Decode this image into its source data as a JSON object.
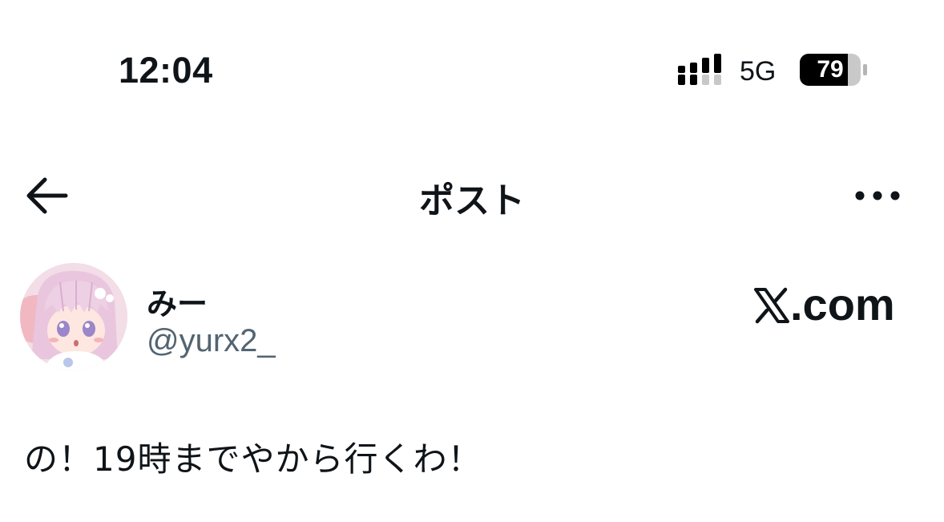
{
  "status_bar": {
    "time": "12:04",
    "network": "5G",
    "battery": "79",
    "battery_level_percent": 79
  },
  "nav": {
    "title": "ポスト",
    "back_icon": "arrow-left-icon",
    "more_icon": "ellipsis-icon"
  },
  "author": {
    "display_name": "みー",
    "handle": "@yurx2_",
    "avatar_icon": "anime-girl-avatar"
  },
  "brand": {
    "logo": "x-logo-icon",
    "domain": ".com"
  },
  "post": {
    "text": "の！19時までやから行くわ！"
  },
  "colors": {
    "text": "#0f1419",
    "secondary_text": "#536471",
    "background": "#ffffff"
  }
}
